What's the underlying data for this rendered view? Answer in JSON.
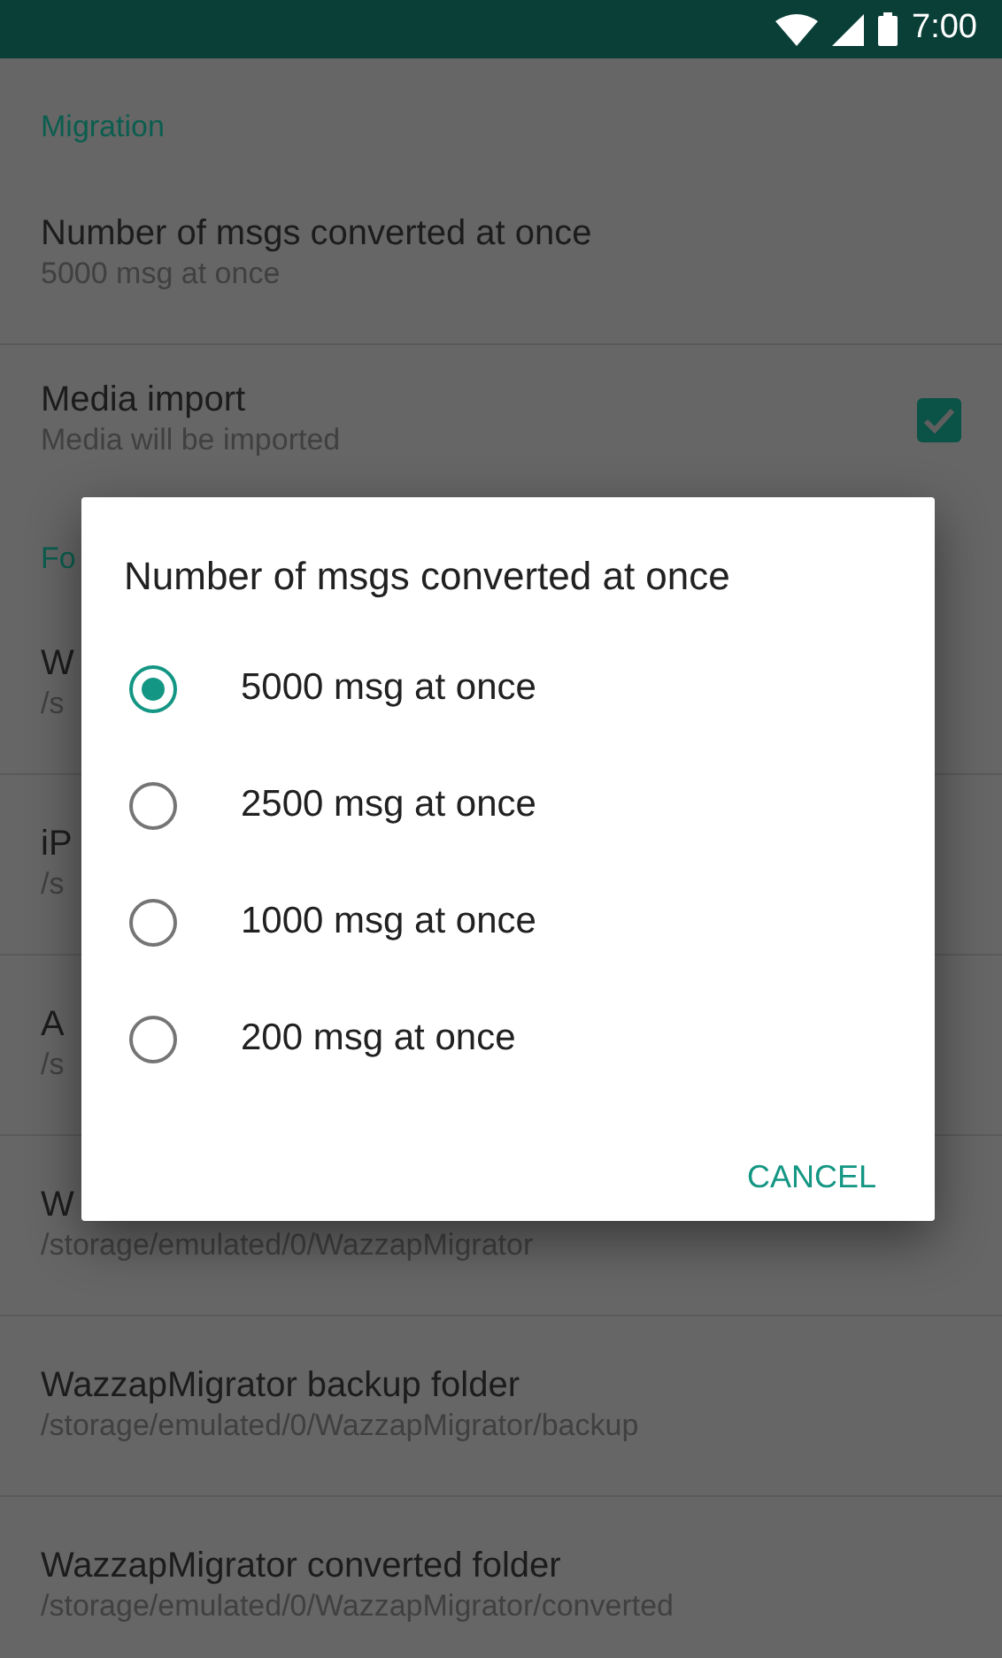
{
  "status_bar": {
    "time": "7:00"
  },
  "settings": [
    {
      "kind": "header",
      "title": "Migration"
    },
    {
      "kind": "item",
      "title": "Number of msgs converted at once",
      "subtitle": "5000 msg at once"
    },
    {
      "kind": "checkbox",
      "title": "Media import",
      "subtitle": "Media will be imported",
      "checked": true
    },
    {
      "kind": "header",
      "title": "Fo"
    },
    {
      "kind": "item",
      "title": "W",
      "subtitle": "/s"
    },
    {
      "kind": "item",
      "title": "iP",
      "subtitle": "/s"
    },
    {
      "kind": "item",
      "title": "A",
      "subtitle": "/s"
    },
    {
      "kind": "item",
      "title": "W",
      "subtitle": "/storage/emulated/0/WazzapMigrator"
    },
    {
      "kind": "item",
      "title": "WazzapMigrator backup folder",
      "subtitle": "/storage/emulated/0/WazzapMigrator/backup"
    },
    {
      "kind": "item",
      "title": "WazzapMigrator converted folder",
      "subtitle": "/storage/emulated/0/WazzapMigrator/converted"
    }
  ],
  "dialog": {
    "title": "Number of msgs converted at once",
    "options": [
      {
        "label": "5000 msg at once",
        "selected": true
      },
      {
        "label": "2500 msg at once",
        "selected": false
      },
      {
        "label": "1000 msg at once",
        "selected": false
      },
      {
        "label": "200 msg at once",
        "selected": false
      }
    ],
    "buttons": [
      "CANCEL"
    ]
  }
}
